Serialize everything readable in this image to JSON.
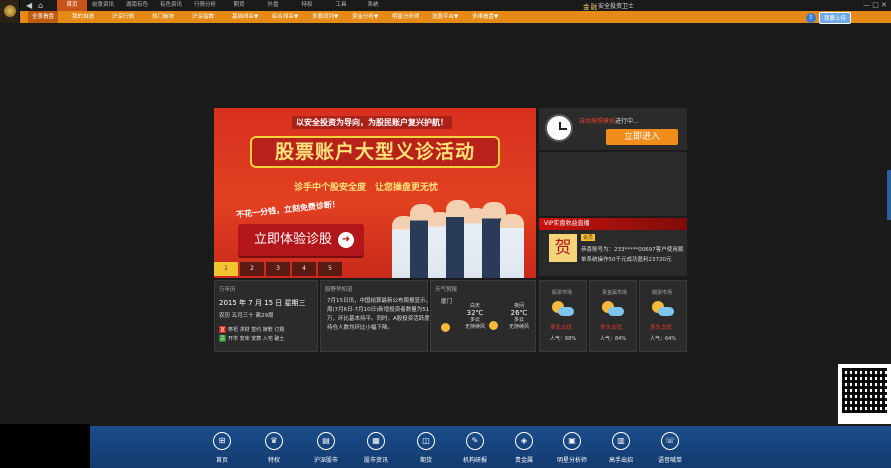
{
  "topbar": {
    "menus": [
      "首页",
      "前景资讯",
      "湖南有色",
      "有色资讯",
      "行情分析",
      "期货",
      "外盘",
      "特权",
      "工具",
      "系统"
    ],
    "brand_mark": "金融",
    "brand_text": "安全投资卫士",
    "window_controls": "— □ ✕"
  },
  "navbar": {
    "items": [
      "全景看盘",
      "我的自选",
      "沪深行情",
      "热门板块",
      "沪深指数",
      "基础排名▼",
      "综合排名▼",
      "多股同列▼",
      "资金分析▼",
      "明星分析师",
      "选股平台▼",
      "多维看盘▼"
    ],
    "upload_label": "我要上传"
  },
  "banner": {
    "tagline": "以安全投资为导向，为股民账户复兴护航！",
    "headline": "股票账户大型义诊活动",
    "subline": "诊手中个股安全度　让您操盘更无忧",
    "free_text": "不花一分钱，立刻免费诊断！",
    "cta": "立即体验诊股",
    "cta_arrow": "➜",
    "tabs": [
      "1",
      "2",
      "3",
      "4",
      "5"
    ],
    "active_tab": 0
  },
  "live_panel": {
    "status_highlight": "自动按照模拟",
    "status_rest": "进行中...",
    "enter_label": "立即进入"
  },
  "vip_panel": {
    "title": "VIP实盘收益直播",
    "badge": "会员",
    "char": "贺",
    "line1": "恭喜账号为：233*****00697客户使用顺",
    "line2": "单系统操作50千元成功盈利23720元"
  },
  "calendar": {
    "title": "万年历",
    "date": "2015 年 7 月 15 日 星期三",
    "lunar": "农历 五月三十 离29周",
    "yi_tag": "宜",
    "yi": "祭祀 求财 签约 嫁娶 订婚",
    "ji_tag": "忌",
    "ji": "开市 安床 安葬 入宅 破土"
  },
  "news": {
    "title": "股野早知道",
    "body": "7月15日讯，中国结算最新公布周报显示，上周(7月6日-7月10日)新增投资者数量为51.3万，环比基本持平。同时，A股投资活跃度、持仓人数均环比小幅下降。"
  },
  "weather": {
    "title": "天气预报",
    "city": "厦门",
    "today": {
      "label": "白天",
      "temp": "32℃",
      "cond": "多云",
      "wind": "无持续风"
    },
    "tomorrow": {
      "label": "夜间",
      "temp": "26℃",
      "cond": "多云",
      "wind": "无持续风"
    }
  },
  "markets": [
    {
      "name": "股票市场",
      "signal": "多头占优",
      "popularity": "人气：68%"
    },
    {
      "name": "贵金属市场",
      "signal": "多头占优",
      "popularity": "人气：84%"
    },
    {
      "name": "期货市场",
      "signal": "多头占优",
      "popularity": "人气：64%"
    }
  ],
  "bottombar": {
    "items": [
      {
        "label": "首页",
        "icon": "windows-icon"
      },
      {
        "label": "特权",
        "icon": "vip-icon"
      },
      {
        "label": "沪深股市",
        "icon": "stock-icon"
      },
      {
        "label": "股市资讯",
        "icon": "news-icon"
      },
      {
        "label": "期货",
        "icon": "futures-icon"
      },
      {
        "label": "机构研报",
        "icon": "report-icon"
      },
      {
        "label": "贵金属",
        "icon": "gold-icon"
      },
      {
        "label": "明星分析师",
        "icon": "analyst-icon"
      },
      {
        "label": "高手出招",
        "icon": "expert-icon"
      },
      {
        "label": "语音喊单",
        "icon": "voice-icon"
      }
    ]
  },
  "colors": {
    "nav_orange": "#e58a16",
    "banner_red": "#d8301f",
    "bottom_blue": "#1b4d8a",
    "signal_red": "#f03a2b"
  }
}
